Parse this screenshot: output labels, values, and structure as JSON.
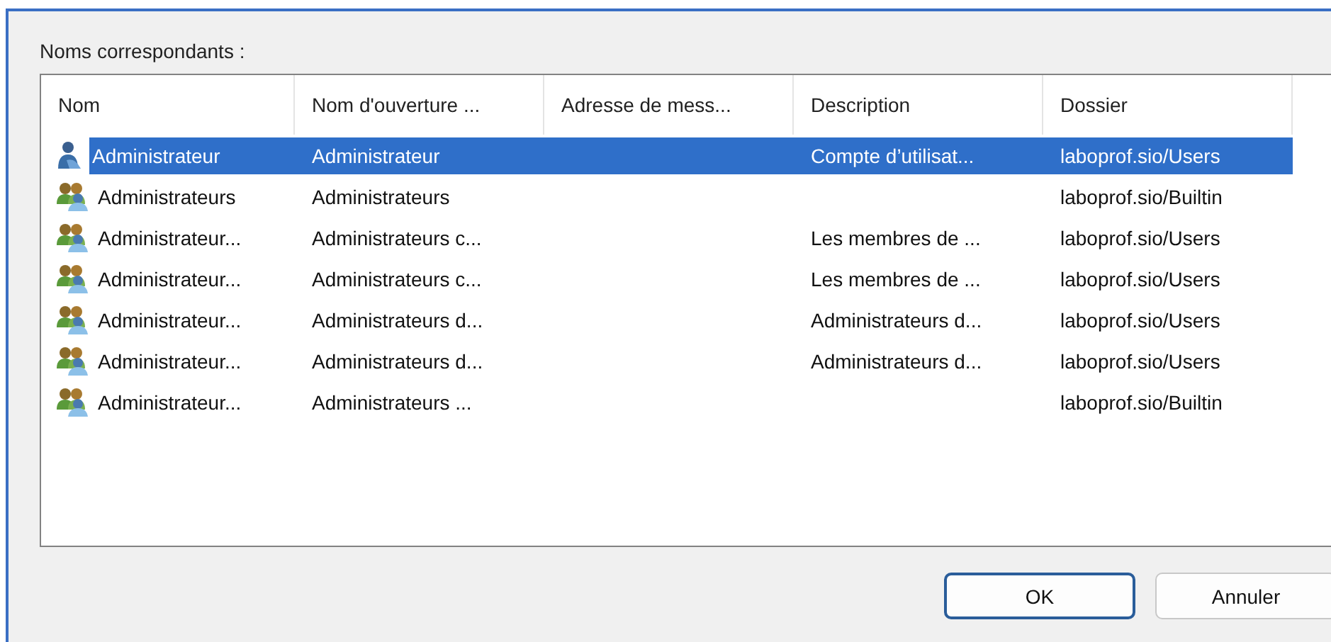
{
  "label": "Noms correspondants :",
  "columns": [
    "Nom",
    "Nom d'ouverture ...",
    "Adresse de mess...",
    "Description",
    "Dossier"
  ],
  "rows": [
    {
      "kind": "user",
      "selected": true,
      "cells": [
        "Administrateur",
        "Administrateur",
        "",
        "Compte d’utilisat...",
        "laboprof.sio/Users"
      ]
    },
    {
      "kind": "group",
      "selected": false,
      "cells": [
        "Administrateurs",
        "Administrateurs",
        "",
        "",
        "laboprof.sio/Builtin"
      ]
    },
    {
      "kind": "group",
      "selected": false,
      "cells": [
        "Administrateur...",
        "Administrateurs c...",
        "",
        "Les membres de ...",
        "laboprof.sio/Users"
      ]
    },
    {
      "kind": "group",
      "selected": false,
      "cells": [
        "Administrateur...",
        "Administrateurs c...",
        "",
        "Les membres de ...",
        "laboprof.sio/Users"
      ]
    },
    {
      "kind": "group",
      "selected": false,
      "cells": [
        "Administrateur...",
        "Administrateurs d...",
        "",
        "Administrateurs d...",
        "laboprof.sio/Users"
      ]
    },
    {
      "kind": "group",
      "selected": false,
      "cells": [
        "Administrateur...",
        "Administrateurs d...",
        "",
        "Administrateurs d...",
        "laboprof.sio/Users"
      ]
    },
    {
      "kind": "group",
      "selected": false,
      "cells": [
        "Administrateur...",
        "Administrateurs ...",
        "",
        "",
        "laboprof.sio/Builtin"
      ]
    }
  ],
  "buttons": [
    {
      "label": "OK",
      "default": true
    },
    {
      "label": "Annuler",
      "default": false
    }
  ]
}
